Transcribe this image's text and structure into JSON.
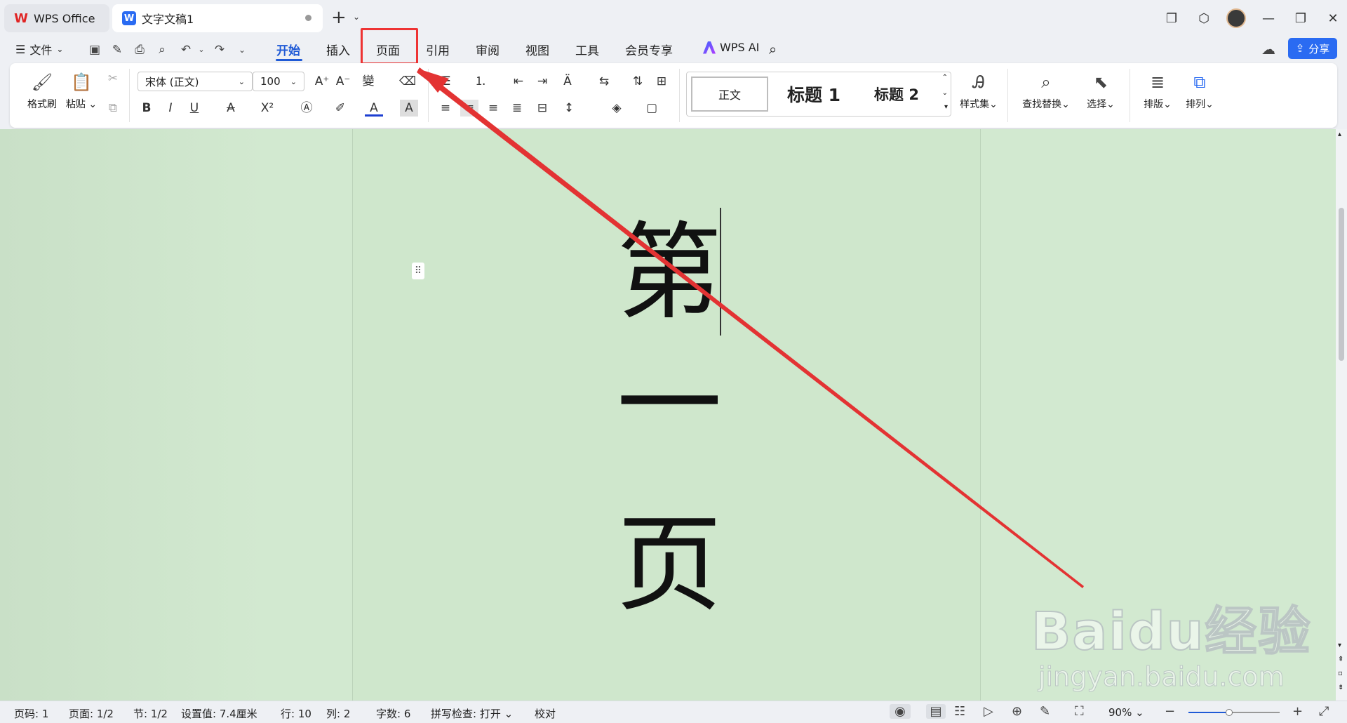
{
  "tabs": [
    {
      "label": "WPS Office"
    },
    {
      "label": "文字文稿1"
    }
  ],
  "menubar": {
    "file": "文件",
    "tabs": [
      "开始",
      "插入",
      "页面",
      "引用",
      "审阅",
      "视图",
      "工具",
      "会员专享"
    ],
    "active_tab": "开始",
    "highlighted_tab": "页面",
    "wps_ai": "WPS AI",
    "share": "分享"
  },
  "ribbon": {
    "format_painter": "格式刷",
    "paste": "粘贴",
    "font_name": "宋体 (正文)",
    "font_size": "100",
    "styles": {
      "normal": "正文",
      "h1": "标题 1",
      "h2": "标题 2"
    },
    "style_set": "样式集",
    "find_replace": "查找替换",
    "select": "选择",
    "layout": "排版",
    "arrange": "排列"
  },
  "document": {
    "chars": [
      "第",
      "一",
      "页"
    ]
  },
  "status": {
    "page_code": "页码: 1",
    "page": "页面: 1/2",
    "section": "节: 1/2",
    "setting": "设置值: 7.4厘米",
    "row": "行: 10",
    "col": "列: 2",
    "word_count": "字数: 6",
    "spell_check": "拼写检查: 打开",
    "proofread": "校对",
    "zoom": "90%"
  },
  "watermark": {
    "logo": "Baidu经验",
    "url": "jingyan.baidu.com"
  },
  "colors": {
    "accent": "#1f5ad6",
    "annotation": "#e33333",
    "page_bg": "#cfe7cc"
  }
}
